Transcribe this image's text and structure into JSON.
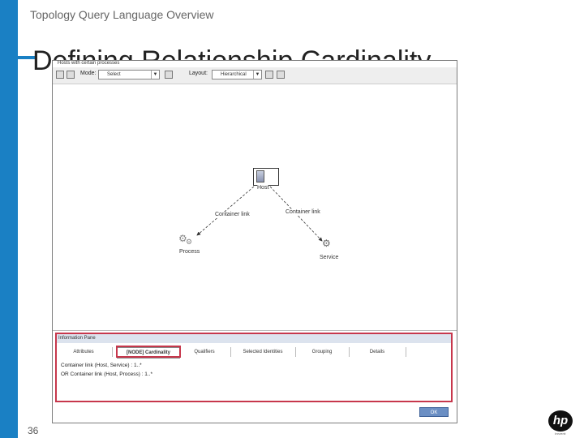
{
  "slide": {
    "kicker": "Topology Query Language Overview",
    "title": "Defining Relationship Cardinality",
    "page_number": "36",
    "brand_color": "#1a80c4",
    "highlight_color": "#c7374c"
  },
  "window": {
    "subtitle": "Hosts with certain processes",
    "toolbar": {
      "mode_label": "Mode:",
      "mode_value": "Select",
      "layout_label": "Layout:",
      "layout_value": "Hierarchical"
    },
    "graph": {
      "nodes": {
        "host": "Host",
        "process": "Process",
        "service": "Service"
      },
      "edges": {
        "left": "Container link",
        "right": "Container link"
      }
    },
    "information_pane": {
      "header": "Information Pane",
      "tabs": [
        {
          "label": "Attributes"
        },
        {
          "label": "Cardinality"
        },
        {
          "label": "Qualifiers"
        },
        {
          "label": "Selected Identities"
        },
        {
          "label": "Grouping"
        },
        {
          "label": "Details"
        }
      ],
      "active_tab": "Cardinality",
      "active_tab_prefix": "[NODE]",
      "lines": [
        "Container link (Host, Service) : 1..*",
        "OR Container link (Host, Process) : 1..*"
      ]
    },
    "ok_label": "OK"
  }
}
